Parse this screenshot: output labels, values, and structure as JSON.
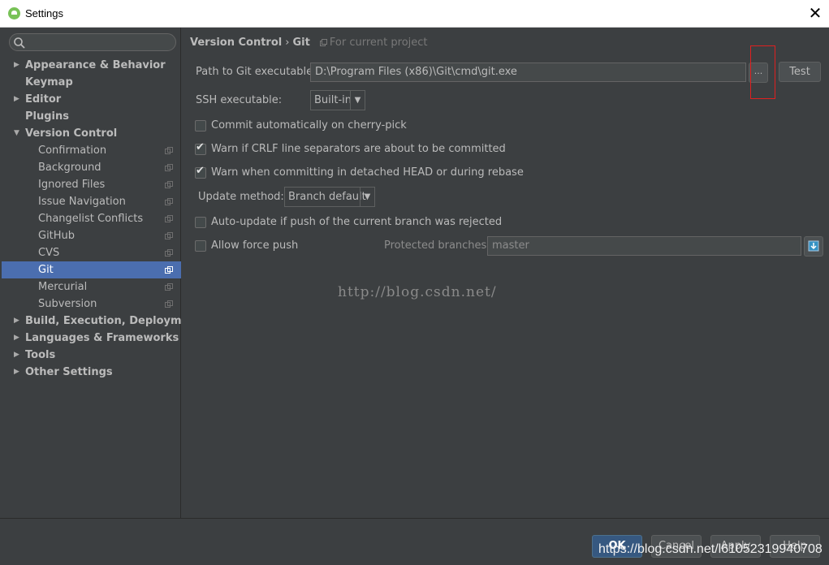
{
  "window": {
    "title": "Settings",
    "close_glyph": "✕"
  },
  "sidebar": {
    "search_placeholder": "",
    "items": [
      {
        "label": "Appearance & Behavior",
        "expandable": true,
        "expanded": false
      },
      {
        "label": "Keymap",
        "expandable": false
      },
      {
        "label": "Editor",
        "expandable": true,
        "expanded": false
      },
      {
        "label": "Plugins",
        "expandable": false
      },
      {
        "label": "Version Control",
        "expandable": true,
        "expanded": true
      },
      {
        "label": "Confirmation",
        "child": true
      },
      {
        "label": "Background",
        "child": true
      },
      {
        "label": "Ignored Files",
        "child": true
      },
      {
        "label": "Issue Navigation",
        "child": true
      },
      {
        "label": "Changelist Conflicts",
        "child": true
      },
      {
        "label": "GitHub",
        "child": true
      },
      {
        "label": "CVS",
        "child": true
      },
      {
        "label": "Git",
        "child": true,
        "selected": true
      },
      {
        "label": "Mercurial",
        "child": true
      },
      {
        "label": "Subversion",
        "child": true
      },
      {
        "label": "Build, Execution, Deployment",
        "expandable": true,
        "expanded": false
      },
      {
        "label": "Languages & Frameworks",
        "expandable": true,
        "expanded": false
      },
      {
        "label": "Tools",
        "expandable": true,
        "expanded": false
      },
      {
        "label": "Other Settings",
        "expandable": true,
        "expanded": false
      }
    ]
  },
  "breadcrumb": {
    "parent": "Version Control",
    "separator": "›",
    "current": "Git",
    "scope": "For current project"
  },
  "git": {
    "path_label": "Path to Git executable:",
    "path_value": "D:\\Program Files (x86)\\Git\\cmd\\git.exe",
    "browse_label": "...",
    "test_label": "Test",
    "ssh_label": "SSH executable:",
    "ssh_value": "Built-in",
    "commit_cherry_label": "Commit automatically on cherry-pick",
    "warn_crlf_label": "Warn if CRLF line separators are about to be committed",
    "warn_detached_label": "Warn when committing in detached HEAD or during rebase",
    "update_method_label": "Update method:",
    "update_method_value": "Branch default",
    "auto_update_label": "Auto-update if push of the current branch was rejected",
    "force_push_label": "Allow force push",
    "protected_label": "Protected branches:",
    "protected_value": "master"
  },
  "checkbox_states": {
    "commit_cherry": false,
    "warn_crlf": true,
    "warn_detached": true,
    "auto_update": false,
    "force_push": false
  },
  "watermark": "http://blog.csdn.net/",
  "footer": {
    "ok": "OK",
    "cancel": "Cancel",
    "apply": "Apply",
    "help": "Help"
  },
  "url_watermark": "https://blog.csdn.net/l61052319940708",
  "colors": {
    "background": "#3c3f41",
    "selection": "#4b6eaf",
    "annotation": "#e02020",
    "primary_button": "#365880"
  }
}
